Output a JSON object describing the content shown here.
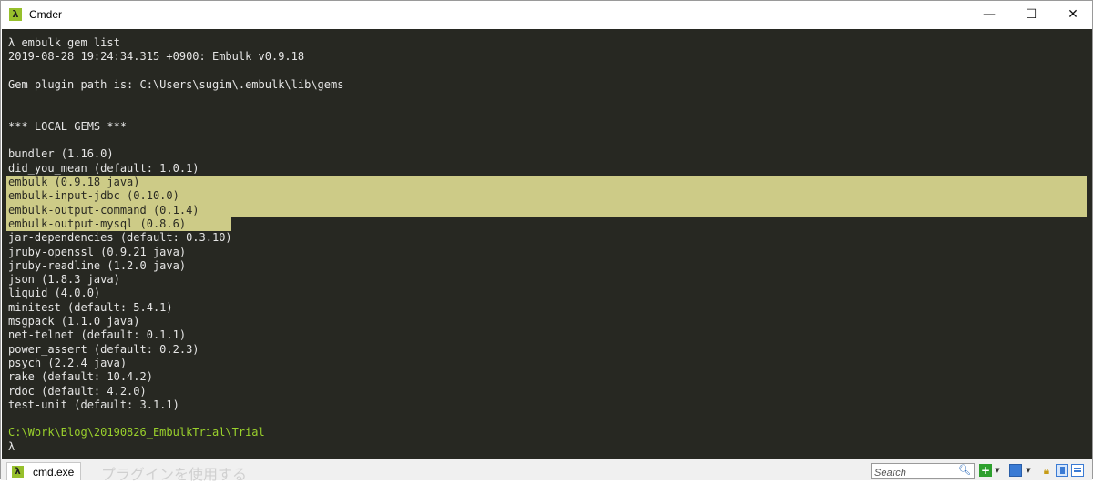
{
  "window": {
    "title": "Cmder",
    "app_icon": "λ",
    "minimize_glyph": "—",
    "maximize_glyph": "☐",
    "close_glyph": "✕"
  },
  "terminal": {
    "lines": [
      "λ embulk gem list",
      "2019-08-28 19:24:34.315 +0900: Embulk v0.9.18",
      "",
      "Gem plugin path is: C:\\Users\\sugim\\.embulk\\lib\\gems",
      "",
      "",
      "*** LOCAL GEMS ***",
      "",
      "bundler (1.16.0)",
      "did_you_mean (default: 1.0.1)",
      "embulk (0.9.18 java)",
      "embulk-input-jdbc (0.10.0)",
      "embulk-output-command (0.1.4)",
      "embulk-output-mysql (0.8.6)",
      "jar-dependencies (default: 0.3.10)",
      "jruby-openssl (0.9.21 java)",
      "jruby-readline (1.2.0 java)",
      "json (1.8.3 java)",
      "liquid (4.0.0)",
      "minitest (default: 5.4.1)",
      "msgpack (1.1.0 java)",
      "net-telnet (default: 0.1.1)",
      "power_assert (default: 0.2.3)",
      "psych (2.2.4 java)",
      "rake (default: 10.4.2)",
      "rdoc (default: 4.2.0)",
      "test-unit (default: 3.1.1)",
      "",
      "C:\\Work\\Blog\\20190826_EmbulkTrial\\Trial",
      "λ"
    ],
    "highlighted_line_indices": [
      10,
      11,
      12,
      13
    ],
    "path_line_index": 28,
    "colors": {
      "background": "#272822",
      "text": "#e6e6e6",
      "highlight": "#cdcb87",
      "path": "#9ad12c"
    }
  },
  "statusbar": {
    "tab_label": "cmd.exe",
    "tab_icon": "λ",
    "search_placeholder": "Search",
    "background_ghost_text": "プラグインを使用する",
    "icons": [
      "add-icon",
      "dropdown-icon",
      "view-icon",
      "dropdown-icon",
      "lock-icon",
      "split-icon",
      "menu-icon"
    ]
  }
}
